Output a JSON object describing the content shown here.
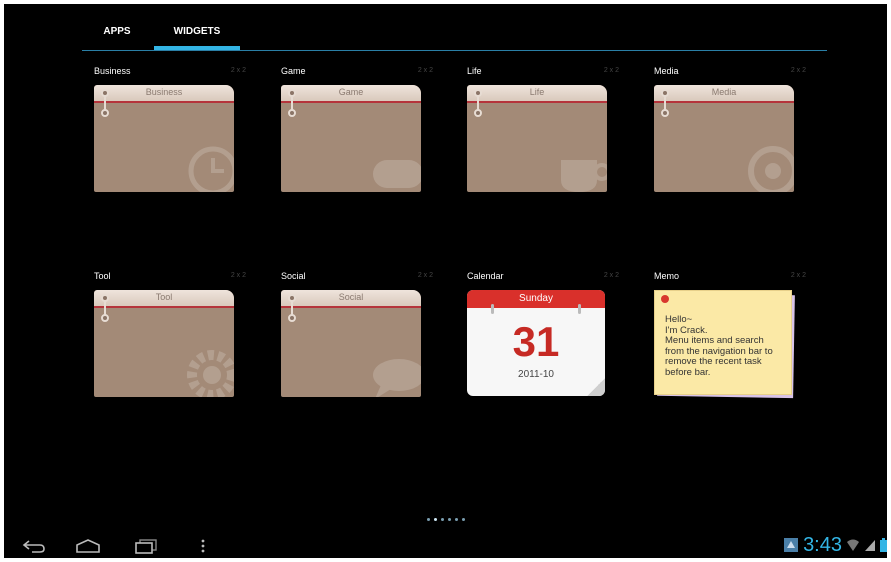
{
  "tabs": [
    {
      "label": "APPS"
    },
    {
      "label": "WIDGETS"
    }
  ],
  "widgets": [
    {
      "title": "Business",
      "size": "2 x 2",
      "header": "Business",
      "icon": "clock-icon"
    },
    {
      "title": "Game",
      "size": "2 x 2",
      "header": "Game",
      "icon": "gamepad-icon"
    },
    {
      "title": "Life",
      "size": "2 x 2",
      "header": "Life",
      "icon": "cup-icon"
    },
    {
      "title": "Media",
      "size": "2 x 2",
      "header": "Media",
      "icon": "speaker-icon"
    },
    {
      "title": "Tool",
      "size": "2 x 2",
      "header": "Tool",
      "icon": "gear-icon"
    },
    {
      "title": "Social",
      "size": "2 x 2",
      "header": "Social",
      "icon": "chat-bubble-icon"
    },
    {
      "title": "Calendar",
      "size": "2 x 2",
      "weekday": "Sunday",
      "day": "31",
      "year_month": "2011-10"
    },
    {
      "title": "Memo",
      "size": "2 x 2",
      "text": "Hello~\nI'm Crack.\nMenu items and search from the navigation bar to remove the recent task before bar."
    }
  ],
  "pager": {
    "pages": 6,
    "current": 1
  },
  "status": {
    "time": "3:43"
  },
  "colors": {
    "accent": "#33b5e5",
    "calendar_red": "#d9302b",
    "widget_body": "#a38a77"
  }
}
